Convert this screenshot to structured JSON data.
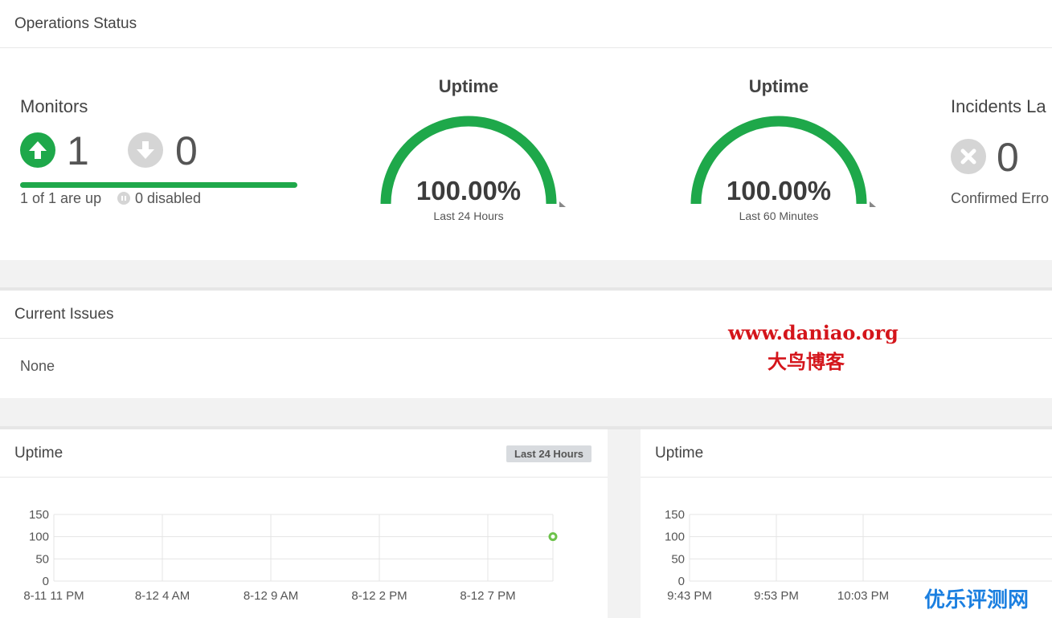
{
  "ops": {
    "title": "Operations Status",
    "monitors": {
      "title": "Monitors",
      "up_count": "1",
      "down_count": "0",
      "up_text": "1 of 1 are up",
      "disabled_text": "0 disabled"
    },
    "gauges": [
      {
        "title": "Uptime",
        "value": "100.00%",
        "label": "Last 24 Hours",
        "fraction": 1.0
      },
      {
        "title": "Uptime",
        "value": "100.00%",
        "label": "Last 60 Minutes",
        "fraction": 1.0
      }
    ],
    "incidents": {
      "title": "Incidents La",
      "count": "0",
      "label": "Confirmed Erro"
    }
  },
  "issues": {
    "title": "Current Issues",
    "body": "None"
  },
  "uptime_left": {
    "title": "Uptime",
    "badge": "Last 24 Hours"
  },
  "uptime_right": {
    "title": "Uptime"
  },
  "watermark": {
    "line1": "www.daniao.org",
    "line2": "大鸟博客",
    "corner": "优乐评测网"
  },
  "colors": {
    "green": "#1ea84a",
    "gray_icon": "#d5d5d5"
  },
  "chart_data": [
    {
      "type": "line",
      "title": "Uptime",
      "y_ticks": [
        "150",
        "100",
        "50",
        "0"
      ],
      "ylim": [
        0,
        150
      ],
      "x_ticks": [
        "8-11 11 PM",
        "8-12 4 AM",
        "8-12 9 AM",
        "8-12 2 PM",
        "8-12 7 PM"
      ],
      "series": [
        {
          "values": [
            100
          ]
        }
      ],
      "grid": true
    },
    {
      "type": "line",
      "title": "Uptime",
      "y_ticks": [
        "150",
        "100",
        "50",
        "0"
      ],
      "ylim": [
        0,
        150
      ],
      "x_ticks": [
        "9:43 PM",
        "9:53 PM",
        "10:03 PM"
      ],
      "grid": true
    }
  ]
}
